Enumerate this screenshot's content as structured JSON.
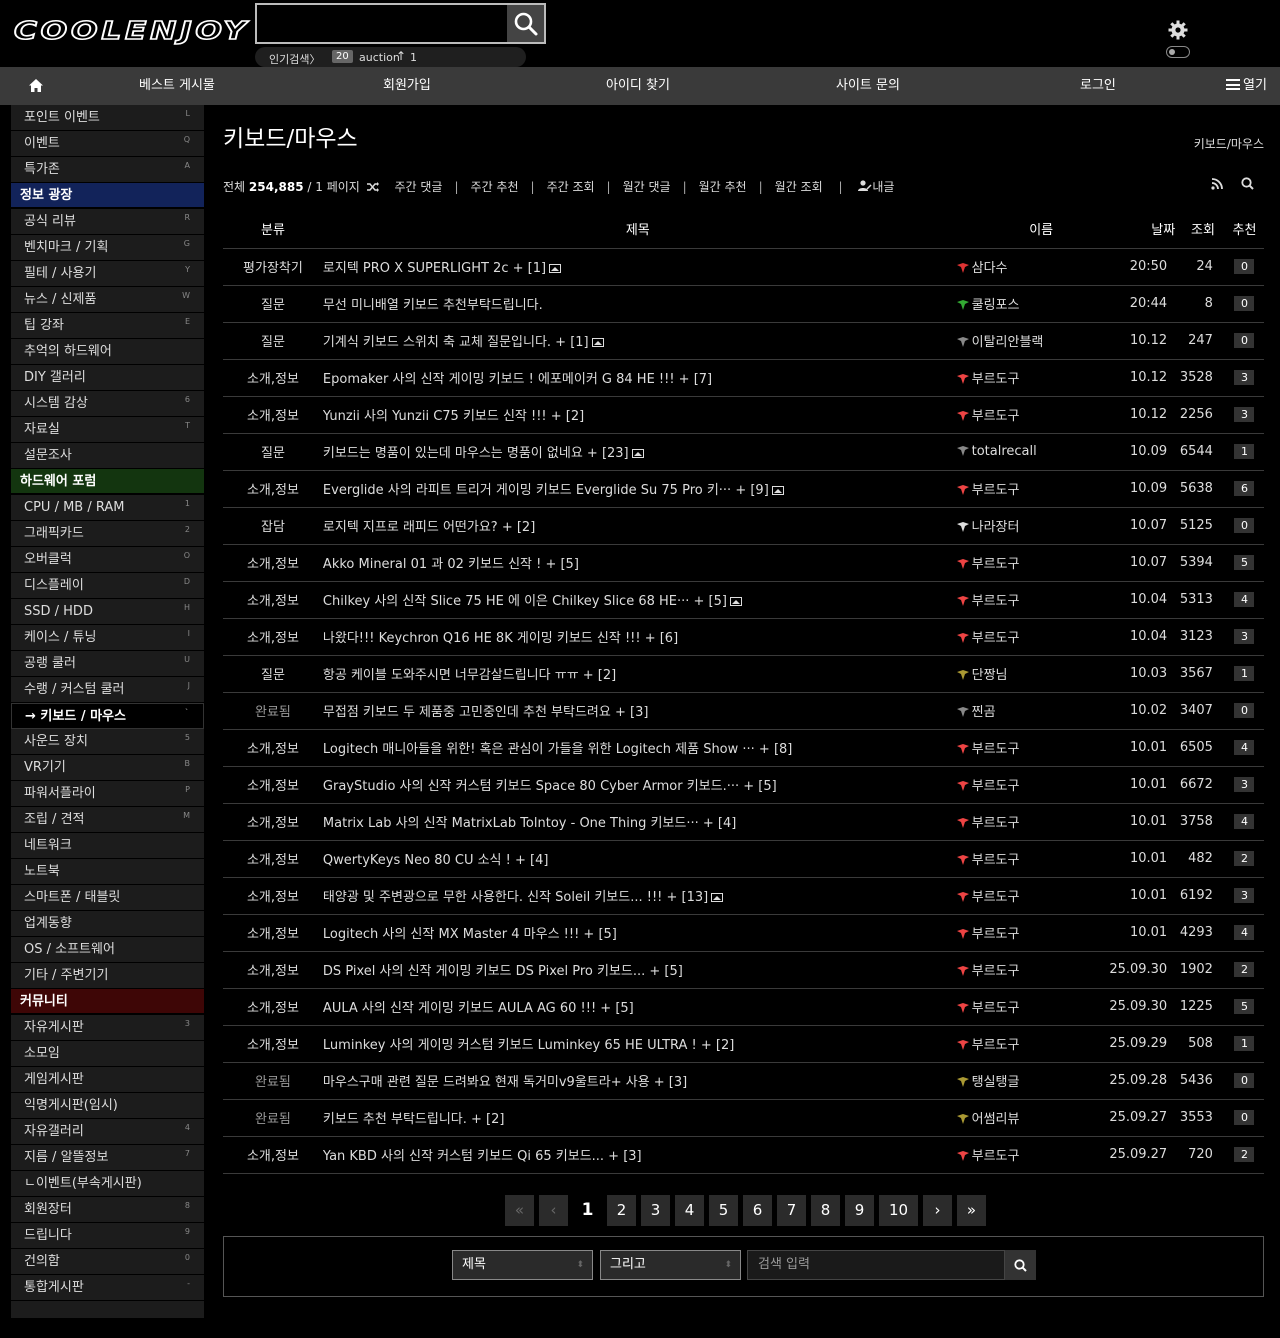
{
  "header": {
    "logo": "COOLENJOY",
    "search_placeholder": "",
    "hot": {
      "label": "인기검색〉",
      "rank": "20",
      "keyword": "auction",
      "arrow": "↑",
      "count": "1"
    }
  },
  "nav": {
    "items": [
      "베스트 게시물",
      "회원가입",
      "아이디 찾기",
      "사이트 문의",
      "로그인"
    ],
    "open_label": "열기"
  },
  "sidebar": {
    "rows": [
      {
        "type": "item",
        "label": "포인트 이벤트",
        "key": "L"
      },
      {
        "type": "item",
        "label": "이벤트",
        "key": "Q"
      },
      {
        "type": "item",
        "label": "특가존",
        "key": "A"
      },
      {
        "type": "head",
        "label": "정보 광장",
        "color": "blue"
      },
      {
        "type": "item",
        "label": "공식 리뷰",
        "key": "R"
      },
      {
        "type": "item",
        "label": "벤치마크 / 기획",
        "key": "G"
      },
      {
        "type": "item",
        "label": "필테 / 사용기",
        "key": "Y"
      },
      {
        "type": "item",
        "label": "뉴스 / 신제품",
        "key": "W"
      },
      {
        "type": "item",
        "label": "팁 강좌",
        "key": "E"
      },
      {
        "type": "item",
        "label": "추억의 하드웨어",
        "key": ""
      },
      {
        "type": "item",
        "label": "DIY 갤러리",
        "key": ""
      },
      {
        "type": "item",
        "label": "시스템 감상",
        "key": "6"
      },
      {
        "type": "item",
        "label": "자료실",
        "key": "T"
      },
      {
        "type": "item",
        "label": "설문조사",
        "key": ""
      },
      {
        "type": "head",
        "label": "하드웨어 포럼",
        "color": "green"
      },
      {
        "type": "item",
        "label": "CPU / MB / RAM",
        "key": "1"
      },
      {
        "type": "item",
        "label": "그래픽카드",
        "key": "2"
      },
      {
        "type": "item",
        "label": "오버클럭",
        "key": "O"
      },
      {
        "type": "item",
        "label": "디스플레이",
        "key": "D"
      },
      {
        "type": "item",
        "label": "SSD / HDD",
        "key": "H"
      },
      {
        "type": "item",
        "label": "케이스 / 튜닝",
        "key": "I"
      },
      {
        "type": "item",
        "label": "공랭 쿨러",
        "key": "U"
      },
      {
        "type": "item",
        "label": "수랭 / 커스텀 쿨러",
        "key": "J"
      },
      {
        "type": "active",
        "label": "→ 키보드 / 마우스",
        "key": "`"
      },
      {
        "type": "item",
        "label": "사운드 장치",
        "key": "5"
      },
      {
        "type": "item",
        "label": "VR기기",
        "key": "B"
      },
      {
        "type": "item",
        "label": "파워서플라이",
        "key": "P"
      },
      {
        "type": "item",
        "label": "조립 / 견적",
        "key": "M"
      },
      {
        "type": "item",
        "label": "네트워크",
        "key": ""
      },
      {
        "type": "item",
        "label": "노트북",
        "key": ""
      },
      {
        "type": "item",
        "label": "스마트폰 / 태블릿",
        "key": ""
      },
      {
        "type": "item",
        "label": "업계동향",
        "key": ""
      },
      {
        "type": "item",
        "label": "OS / 소프트웨어",
        "key": ""
      },
      {
        "type": "item",
        "label": "기타 / 주변기기",
        "key": ""
      },
      {
        "type": "head",
        "label": "커뮤니티",
        "color": "red"
      },
      {
        "type": "item",
        "label": "자유게시판",
        "key": "3"
      },
      {
        "type": "item",
        "label": "소모임",
        "key": ""
      },
      {
        "type": "item",
        "label": "게임게시판",
        "key": ""
      },
      {
        "type": "item",
        "label": "익명게시판(임시)",
        "key": ""
      },
      {
        "type": "item",
        "label": "자유갤러리",
        "key": "4"
      },
      {
        "type": "item",
        "label": "지름 / 알뜰정보",
        "key": "7"
      },
      {
        "type": "item",
        "label": "ㄴ이벤트(부속게시판)",
        "key": ""
      },
      {
        "type": "item",
        "label": "회원장터",
        "key": "8"
      },
      {
        "type": "item",
        "label": "드립니다",
        "key": "9"
      },
      {
        "type": "item",
        "label": "건의함",
        "key": "0"
      },
      {
        "type": "item",
        "label": "통합게시판",
        "key": "-"
      }
    ]
  },
  "board": {
    "title": "키보드/마우스",
    "breadcrumb": "키보드/마우스",
    "total_label": "전체",
    "total": "254,885",
    "page_info": "/ 1 페이지",
    "filters": [
      "주간 댓글",
      "주간 추천",
      "주간 조회",
      "월간 댓글",
      "월간 추천",
      "월간 조회"
    ],
    "my_posts": "내글",
    "columns": [
      "분류",
      "제목",
      "이름",
      "날짜",
      "조회",
      "추천"
    ],
    "rows": [
      {
        "cat": "평가장착기",
        "title": "로지텍 PRO X SUPERLIGHT 2c + [1]",
        "img": true,
        "name": "삼다수",
        "lvl": "#d33",
        "date": "20:50",
        "views": "24",
        "rec": "0"
      },
      {
        "cat": "질문",
        "title": "무선 미니배열 키보드 추천부탁드립니다.",
        "img": false,
        "name": "쿨링포스",
        "lvl": "#3a3",
        "date": "20:44",
        "views": "8",
        "rec": "0"
      },
      {
        "cat": "질문",
        "title": "기계식 키보드 스위치 축 교체 질문입니다. + [1]",
        "img": true,
        "name": "이탈리안블랙",
        "lvl": "#888",
        "date": "10.12",
        "views": "247",
        "rec": "0"
      },
      {
        "cat": "소개,정보",
        "title": "Epomaker 사의 신작 게이밍 키보드 ! 에포메이커 G 84 HE !!! + [7]",
        "img": false,
        "name": "부르도구",
        "lvl": "#e44",
        "date": "10.12",
        "views": "3528",
        "rec": "3"
      },
      {
        "cat": "소개,정보",
        "title": "Yunzii 사의 Yunzii C75 키보드 신작 !!! + [2]",
        "img": false,
        "name": "부르도구",
        "lvl": "#e44",
        "date": "10.12",
        "views": "2256",
        "rec": "3"
      },
      {
        "cat": "질문",
        "title": "키보드는 명품이 있는데 마우스는 명품이 없네요 + [23]",
        "img": true,
        "name": "totalrecall",
        "lvl": "#888",
        "date": "10.09",
        "views": "6544",
        "rec": "1"
      },
      {
        "cat": "소개,정보",
        "title": "Everglide 사의 라피트 트리거 게이밍 키보드 Everglide Su 75 Pro 키··· + [9]",
        "img": true,
        "name": "부르도구",
        "lvl": "#e44",
        "date": "10.09",
        "views": "5638",
        "rec": "6"
      },
      {
        "cat": "잡담",
        "title": "로지텍 지프로 래피드 어떤가요? + [2]",
        "img": false,
        "name": "나라장터",
        "lvl": "#ddd",
        "date": "10.07",
        "views": "5125",
        "rec": "0"
      },
      {
        "cat": "소개,정보",
        "title": "Akko Mineral 01 과 02 키보드 신작 ! + [5]",
        "img": false,
        "name": "부르도구",
        "lvl": "#e44",
        "date": "10.07",
        "views": "5394",
        "rec": "5"
      },
      {
        "cat": "소개,정보",
        "title": "Chilkey 사의 신작 Slice 75 HE 에 이은 Chilkey Slice 68 HE··· + [5]",
        "img": true,
        "name": "부르도구",
        "lvl": "#e44",
        "date": "10.04",
        "views": "5313",
        "rec": "4"
      },
      {
        "cat": "소개,정보",
        "title": "나왔다!!! Keychron Q16 HE 8K 게이밍 키보드 신작 !!! + [6]",
        "img": false,
        "name": "부르도구",
        "lvl": "#e44",
        "date": "10.04",
        "views": "3123",
        "rec": "3"
      },
      {
        "cat": "질문",
        "title": "항공 케이블 도와주시면 너무감살드립니다 ㅠㅠ + [2]",
        "img": false,
        "name": "단짱님",
        "lvl": "#a93",
        "date": "10.03",
        "views": "3567",
        "rec": "1"
      },
      {
        "cat": "완료됨",
        "title": "무접점 키보드 두 제품중 고민중인데 추천 부탁드려요 + [3]",
        "img": false,
        "name": "찐곰",
        "lvl": "#888",
        "date": "10.02",
        "views": "3407",
        "rec": "0",
        "done": true
      },
      {
        "cat": "소개,정보",
        "title": "Logitech 매니아들을 위한! 혹은 관심이 가들을 위한 Logitech 제품 Show ··· + [8]",
        "img": false,
        "name": "부르도구",
        "lvl": "#e44",
        "date": "10.01",
        "views": "6505",
        "rec": "4"
      },
      {
        "cat": "소개,정보",
        "title": "GrayStudio 사의 신작 커스텀 키보드 Space 80 Cyber Armor 키보드.··· + [5]",
        "img": false,
        "name": "부르도구",
        "lvl": "#e44",
        "date": "10.01",
        "views": "6672",
        "rec": "3"
      },
      {
        "cat": "소개,정보",
        "title": "Matrix Lab 사의 신작 MatrixLab Tolntoy - One Thing 키보드··· + [4]",
        "img": false,
        "name": "부르도구",
        "lvl": "#e44",
        "date": "10.01",
        "views": "3758",
        "rec": "4"
      },
      {
        "cat": "소개,정보",
        "title": "QwertyKeys Neo 80 CU 소식 ! + [4]",
        "img": false,
        "name": "부르도구",
        "lvl": "#e44",
        "date": "10.01",
        "views": "482",
        "rec": "2"
      },
      {
        "cat": "소개,정보",
        "title": "태양광 및 주변광으로 무한 사용한다. 신작 Soleil 키보드... !!! + [13]",
        "img": true,
        "name": "부르도구",
        "lvl": "#e44",
        "date": "10.01",
        "views": "6192",
        "rec": "3"
      },
      {
        "cat": "소개,정보",
        "title": "Logitech 사의 신작 MX Master 4 마우스 !!! + [5]",
        "img": false,
        "name": "부르도구",
        "lvl": "#e44",
        "date": "10.01",
        "views": "4293",
        "rec": "4"
      },
      {
        "cat": "소개,정보",
        "title": "DS Pixel 사의 신작 게이밍 키보드 DS Pixel Pro 키보드... + [5]",
        "img": false,
        "name": "부르도구",
        "lvl": "#e44",
        "date": "25.09.30",
        "views": "1902",
        "rec": "2"
      },
      {
        "cat": "소개,정보",
        "title": "AULA 사의 신작 게이밍 키보드 AULA AG 60 !!! + [5]",
        "img": false,
        "name": "부르도구",
        "lvl": "#e44",
        "date": "25.09.30",
        "views": "1225",
        "rec": "5"
      },
      {
        "cat": "소개,정보",
        "title": "Luminkey 사의 게이밍 커스텀 키보드 Luminkey 65 HE ULTRA ! + [2]",
        "img": false,
        "name": "부르도구",
        "lvl": "#e44",
        "date": "25.09.29",
        "views": "508",
        "rec": "1"
      },
      {
        "cat": "완료됨",
        "title": "마우스구매 관련 질문 드려봐요 현재 독거미v9울트라+ 사용 + [3]",
        "img": false,
        "name": "탱실탱글",
        "lvl": "#a93",
        "date": "25.09.28",
        "views": "5436",
        "rec": "0",
        "done": true
      },
      {
        "cat": "완료됨",
        "title": "키보드 추천 부탁드립니다. + [2]",
        "img": false,
        "name": "어썸리뷰",
        "lvl": "#a93",
        "date": "25.09.27",
        "views": "3553",
        "rec": "0",
        "done": true
      },
      {
        "cat": "소개,정보",
        "title": "Yan KBD 사의 신작 커스텀 키보드 Qi 65 키보드... + [3]",
        "img": false,
        "name": "부르도구",
        "lvl": "#e44",
        "date": "25.09.27",
        "views": "720",
        "rec": "2"
      }
    ]
  },
  "pager": {
    "first": "«",
    "prev": "‹",
    "pages": [
      "1",
      "2",
      "3",
      "4",
      "5",
      "6",
      "7",
      "8",
      "9",
      "10"
    ],
    "current": "1",
    "next": "›",
    "last": "»"
  },
  "search": {
    "field_select": "제목",
    "op_select": "그리고",
    "input_placeholder": "검색 입력"
  },
  "colors": {
    "nav_bg": "#3a3a3a",
    "head_blue": "#12235a",
    "head_green": "#13350f",
    "head_red": "#3e0606"
  }
}
